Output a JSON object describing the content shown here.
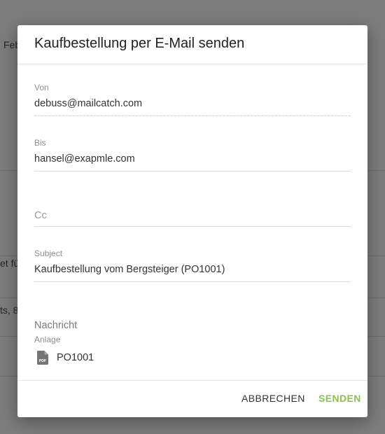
{
  "background": {
    "fragments": [
      "Feb",
      "et fü",
      "ts, 8"
    ]
  },
  "dialog": {
    "title": "Kaufbestellung per E-Mail senden",
    "from": {
      "label": "Von",
      "value": "debuss@mailcatch.com"
    },
    "to": {
      "label": "Bis",
      "value": "hansel@exapmle.com"
    },
    "cc": {
      "placeholder": "Cc"
    },
    "subject": {
      "label": "Subject",
      "value": "Kaufbestellung vom Bergsteiger (PO1001)"
    },
    "message": {
      "label": "Nachricht"
    },
    "attachment": {
      "label": "Anlage",
      "file_name": "PO1001",
      "icon": "pdf-file-icon",
      "icon_text": "PDF"
    },
    "buttons": {
      "cancel": "ABBRECHEN",
      "send": "SENDEN"
    }
  },
  "colors": {
    "accent": "#8bc34a",
    "overlay": "#7b7b7b"
  }
}
